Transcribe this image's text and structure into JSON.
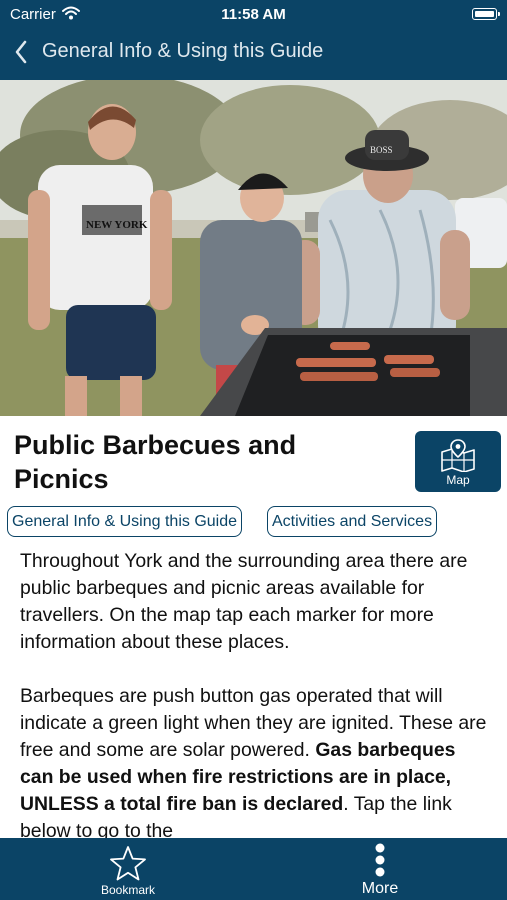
{
  "status_bar": {
    "carrier": "Carrier",
    "time": "11:58 AM"
  },
  "nav": {
    "back_title": "General Info & Using this Guide"
  },
  "hero": {
    "cap_text": "BOSS",
    "shirt_text": "NEW YORK"
  },
  "page": {
    "title": "Public Barbecues and Picnics"
  },
  "map_button": {
    "label": "Map"
  },
  "tags": [
    "General Info & Using this Guide",
    "Activities and Services"
  ],
  "content": {
    "para1": "Throughout York and the surrounding area there are public barbeques and picnic areas available for travellers. On the map tap each marker for more information about these places.",
    "para2_start": "Barbeques are push button gas operated that will indicate a green light when they are ignited. These are free and some are solar powered. ",
    "para2_bold": "Gas barbeques can be used when fire restrictions are in place, UNLESS a total fire ban is declared",
    "para2_end": ". Tap the link below to go to the"
  },
  "tabbar": {
    "bookmark": "Bookmark",
    "more": "More"
  },
  "colors": {
    "brand": "#0b4466",
    "background": "#ffffff",
    "text": "#111111"
  }
}
